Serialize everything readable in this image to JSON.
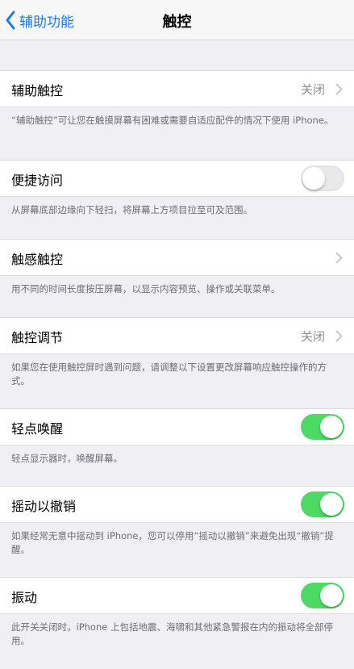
{
  "nav": {
    "back_label": "辅助功能",
    "title": "触控"
  },
  "colors": {
    "accent": "#1a7cf5",
    "switch_on": "#4cd964",
    "background": "#efeff4"
  },
  "settings": [
    {
      "label": "辅助触控",
      "value": "关闭",
      "control": "chevron",
      "footer": "“辅助触控”可让您在触摸屏幕有困难或需要自适应配件的情况下使用 iPhone。"
    },
    {
      "label": "便捷访问",
      "control": "switch",
      "on": false,
      "footer": "从屏幕底部边缘向下轻扫，将屏幕上方项目拉至可及范围。"
    },
    {
      "label": "触感触控",
      "control": "chevron",
      "footer": "用不同的时间长度按压屏幕，以显示内容预览、操作或关联菜单。"
    },
    {
      "label": "触控调节",
      "value": "关闭",
      "control": "chevron",
      "footer": "如果您在使用触控屏时遇到问题，请调整以下设置更改屏幕响应触控操作的方式。"
    },
    {
      "label": "轻点唤醒",
      "control": "switch",
      "on": true,
      "footer": "轻点显示器时，唤醒屏幕。"
    },
    {
      "label": "摇动以撤销",
      "control": "switch",
      "on": true,
      "footer": "如果经常无意中摇动到 iPhone，您可以停用“摇动以撤销”来避免出现“撤销”提醒。"
    },
    {
      "label": "振动",
      "control": "switch",
      "on": true,
      "footer": "此开关关闭时，iPhone 上包括地震、海啸和其他紧急警报在内的振动将全部停用。"
    }
  ]
}
